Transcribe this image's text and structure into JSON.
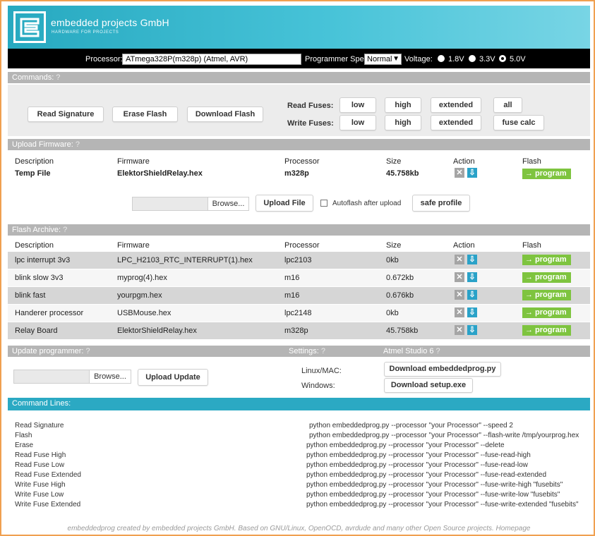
{
  "header": {
    "brand": "embedded projects GmbH",
    "tagline": "HARDWARE FOR PROJECTS"
  },
  "processor_bar": {
    "processor_label": "Processor:",
    "processor_value": "ATmega328P(m328p) (Atmel, AVR)",
    "speed_label": "Programmer Speed:",
    "speed_value": "Normal",
    "voltage_label": "Voltage:",
    "voltages": [
      "1.8V",
      "3.3V",
      "5.0V"
    ],
    "voltage_selected": "5.0V"
  },
  "commands": {
    "title": "Commands:",
    "help": "?",
    "read_signature": "Read Signature",
    "erase_flash": "Erase Flash",
    "download_flash": "Download Flash",
    "read_fuses_label": "Read Fuses:",
    "write_fuses_label": "Write Fuses:",
    "fuse_low": "low",
    "fuse_high": "high",
    "fuse_extended": "extended",
    "fuse_all": "all",
    "fuse_calc": "fuse calc"
  },
  "upload_firmware": {
    "title": "Upload Firmware:",
    "help": "?",
    "columns": [
      "Description",
      "Firmware",
      "Processor",
      "Size",
      "Action",
      "Flash"
    ],
    "row": {
      "description": "Temp File",
      "firmware": "ElektorShieldRelay.hex",
      "processor": "m328p",
      "size": "45.758kb"
    },
    "program_label": "→ program",
    "browse_label": "Browse...",
    "upload_file": "Upload File",
    "autoflash_label": "Autoflash after upload",
    "safe_profile": "safe profile"
  },
  "flash_archive": {
    "title": "Flash Archive:",
    "help": "?",
    "columns": [
      "Description",
      "Firmware",
      "Processor",
      "Size",
      "Action",
      "Flash"
    ],
    "rows": [
      {
        "description": "lpc interrupt 3v3",
        "firmware": "LPC_H2103_RTC_INTERRUPT(1).hex",
        "processor": "lpc2103",
        "size": "0kb"
      },
      {
        "description": "blink slow 3v3",
        "firmware": "myprog(4).hex",
        "processor": "m16",
        "size": "0.672kb"
      },
      {
        "description": "blink fast",
        "firmware": "yourpgm.hex",
        "processor": "m16",
        "size": "0.676kb"
      },
      {
        "description": "Handerer processor",
        "firmware": "USBMouse.hex",
        "processor": "lpc2148",
        "size": "0kb"
      },
      {
        "description": "Relay Board",
        "firmware": "ElektorShieldRelay.hex",
        "processor": "m328p",
        "size": "45.758kb"
      }
    ],
    "program_label": "→ program"
  },
  "update": {
    "title": "Update programmer:",
    "help": "?",
    "settings_label": "Settings:",
    "atmel_label": "Atmel Studio 6",
    "browse_label": "Browse...",
    "upload_update": "Upload Update",
    "linux_label": "Linux/MAC:",
    "windows_label": "Windows:",
    "download_py": "Download embeddedprog.py",
    "download_exe": "Download setup.exe"
  },
  "command_lines": {
    "title": "Command Lines:",
    "items": [
      {
        "name": "Read Signature",
        "cmd": "python embeddedprog.py --processor \"your Processor\" --speed 2"
      },
      {
        "name": "Flash",
        "cmd": "python embeddedprog.py --processor \"your Processor\" --flash-write /tmp/yourprog.hex"
      },
      {
        "name": "Erase",
        "cmd": "python embeddedprog.py --processor \"your Processor\" --delete"
      },
      {
        "name": "Read Fuse High",
        "cmd": "python embeddedprog.py --processor \"your Processor\" --fuse-read-high"
      },
      {
        "name": "Read Fuse Low",
        "cmd": "python embeddedprog.py --processor \"your Processor\" --fuse-read-low"
      },
      {
        "name": "Read Fuse Extended",
        "cmd": "python embeddedprog.py --processor \"your Processor\" --fuse-read-extended"
      },
      {
        "name": "Write Fuse High",
        "cmd": "python embeddedprog.py --processor \"your Processor\" --fuse-write-high \"fusebits\""
      },
      {
        "name": "Write Fuse Low",
        "cmd": "python embeddedprog.py --processor \"your Processor\" --fuse-write-low \"fusebits\""
      },
      {
        "name": "Write Fuse Extended",
        "cmd": "python embeddedprog.py --processor \"your Processor\" --fuse-write-extended \"fusebits\""
      }
    ]
  },
  "footer": "embeddedprog created by embedded projects GmbH. Based on GNU/Linux, OpenOCD, avrdude and many other Open Source projects. Homepage",
  "colors": {
    "header_teal": "#2ba9c3",
    "section_gray": "#b5b5b5",
    "program_green": "#7ec43f",
    "download_blue": "#2aa2c8",
    "frame_orange": "#f0a050"
  },
  "icons": [
    "logo-icon",
    "delete-icon",
    "download-icon",
    "chevron-down-icon",
    "checkbox-icon"
  ]
}
